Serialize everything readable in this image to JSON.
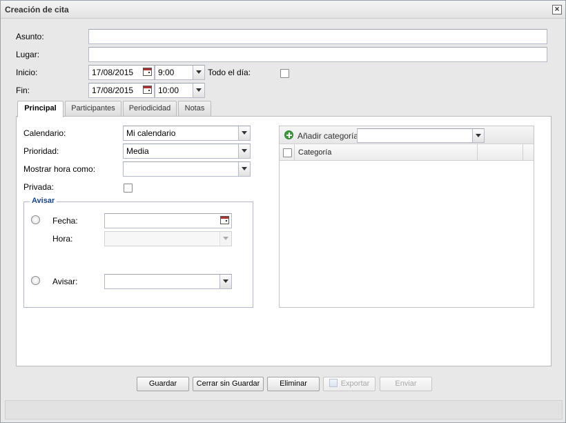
{
  "window": {
    "title": "Creación de cita"
  },
  "form": {
    "asunto_label": "Asunto:",
    "asunto_value": "",
    "lugar_label": "Lugar:",
    "lugar_value": "",
    "inicio_label": "Inicio:",
    "inicio_date": "17/08/2015",
    "inicio_time": "9:00",
    "todo_dia_label": "Todo el día:",
    "fin_label": "Fin:",
    "fin_date": "17/08/2015",
    "fin_time": "10:00"
  },
  "tabs": [
    {
      "label": "Principal"
    },
    {
      "label": "Participantes"
    },
    {
      "label": "Periodicidad"
    },
    {
      "label": "Notas"
    }
  ],
  "principal": {
    "calendario_label": "Calendario:",
    "calendario_value": "Mi calendario",
    "prioridad_label": "Prioridad:",
    "prioridad_value": "Media",
    "mostrar_label": "Mostrar hora como:",
    "mostrar_value": "",
    "privada_label": "Privada:",
    "avisar": {
      "legend": "Avisar",
      "fecha_label": "Fecha:",
      "hora_label": "Hora:",
      "avisar_label": "Avisar:"
    }
  },
  "categorias": {
    "add_label": "Añadir categoría",
    "column_header": "Categoría"
  },
  "buttons": {
    "guardar": "Guardar",
    "cerrar": "Cerrar sin Guardar",
    "eliminar": "Eliminar",
    "exportar": "Exportar",
    "enviar": "Enviar"
  }
}
